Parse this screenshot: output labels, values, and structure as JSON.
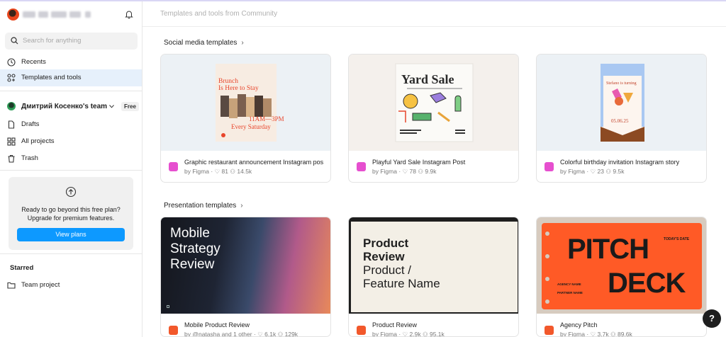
{
  "sidebar": {
    "search_placeholder": "Search for anything",
    "nav": [
      {
        "label": "Recents",
        "icon": "clock-icon"
      },
      {
        "label": "Templates and tools",
        "icon": "templates-icon"
      }
    ],
    "team": {
      "name": "Дмитрий Косенко's team",
      "badge": "Free"
    },
    "team_nav": [
      {
        "label": "Drafts",
        "icon": "file-icon"
      },
      {
        "label": "All projects",
        "icon": "grid-icon"
      },
      {
        "label": "Trash",
        "icon": "trash-icon"
      }
    ],
    "upsell": {
      "line1": "Ready to go beyond this free plan?",
      "line2": "Upgrade for premium features.",
      "button": "View plans"
    },
    "starred": {
      "heading": "Starred",
      "items": [
        {
          "label": "Team project"
        }
      ]
    }
  },
  "main": {
    "header": "Templates and tools from Community",
    "sections": [
      {
        "title": "Social media templates",
        "cards": [
          {
            "title": "Graphic restaurant announcement Instagram pos",
            "author": "by Figma",
            "likes": "81",
            "users": "14.5k",
            "thumb": {
              "line1": "Brunch",
              "line2": "Is Here to Stay",
              "time": "11AM—3PM",
              "day": "Every Saturday"
            }
          },
          {
            "title": "Playful Yard Sale Instagram Post",
            "author": "by Figma",
            "likes": "78",
            "users": "9.9k",
            "thumb": {
              "heading": "Yard Sale"
            }
          },
          {
            "title": "Colorful birthday invitation Instagram story",
            "author": "by Figma",
            "likes": "23",
            "users": "9.5k",
            "thumb": {
              "heading": "Stefano is turning",
              "date": "05.06.25"
            }
          }
        ]
      },
      {
        "title": "Presentation templates",
        "cards": [
          {
            "title": "Mobile Product Review",
            "author": "by @natasha and 1 other",
            "likes": "6.1k",
            "users": "129k",
            "thumb": {
              "line1": "Mobile",
              "line2": "Strategy",
              "line3": "Review"
            }
          },
          {
            "title": "Product Review",
            "author": "by Figma",
            "likes": "2.9k",
            "users": "95.1k",
            "thumb": {
              "line1": "Product",
              "line2": "Review",
              "line3": "Product /",
              "line4": "Feature Name"
            }
          },
          {
            "title": "Agency Pitch",
            "author": "by Figma",
            "likes": "3.7k",
            "users": "89.6k",
            "thumb": {
              "line1": "PITCH",
              "line2": "DECK",
              "date_label": "TODAY'S DATE",
              "agency": "AGENCY NAME",
              "partner": "PARTNER NAME"
            }
          }
        ]
      }
    ]
  },
  "help_label": "?",
  "colors": {
    "accent": "#0d99ff",
    "active_bg": "#e6f0fb",
    "pitch_orange": "#ff5a26"
  }
}
